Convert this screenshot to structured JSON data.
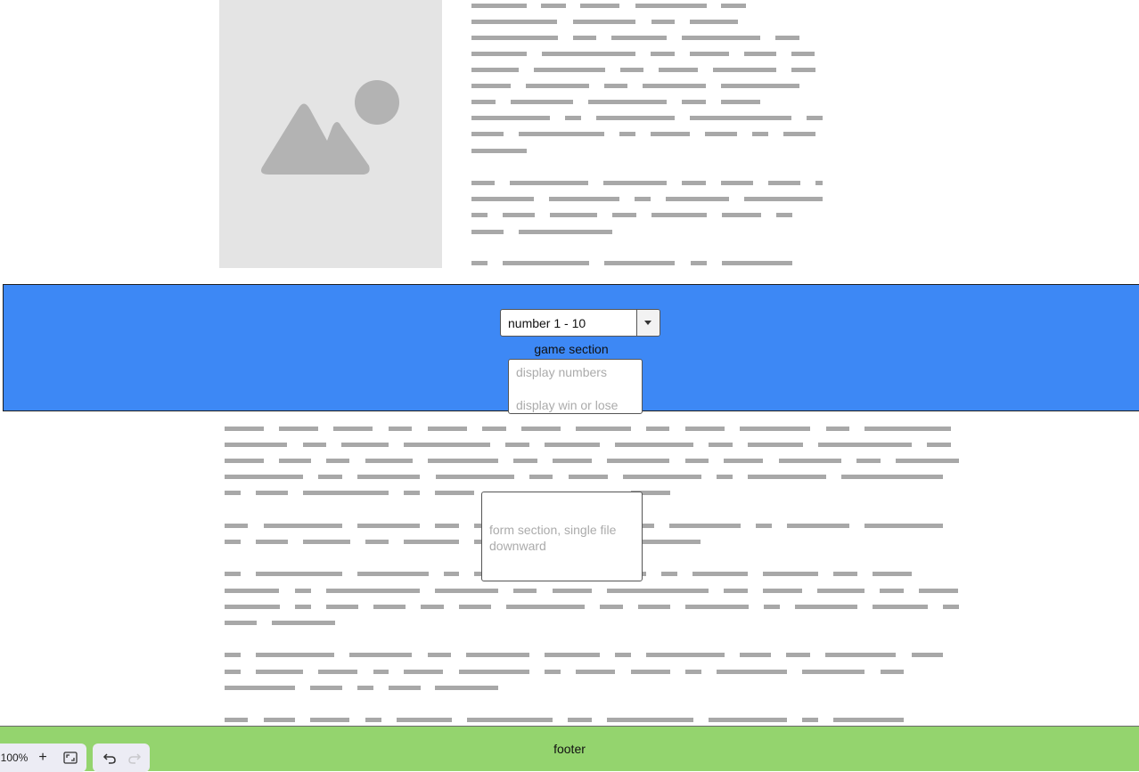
{
  "game_section": {
    "select_value": "number 1 - 10",
    "label": "game section",
    "display_numbers": "display numbers",
    "display_result": "display win or lose",
    "band_color": "#3d88f5"
  },
  "form_section": {
    "text": "form section, single file downward"
  },
  "footer": {
    "label": "footer",
    "color": "#94d46e"
  },
  "toolbar": {
    "zoom_level": "100%",
    "zoom_in": "+",
    "icons": [
      "zoom-in-icon",
      "fit-to-screen-icon",
      "undo-icon",
      "redo-icon"
    ]
  },
  "placeholder_image": {
    "icon": "image-placeholder-icon"
  }
}
